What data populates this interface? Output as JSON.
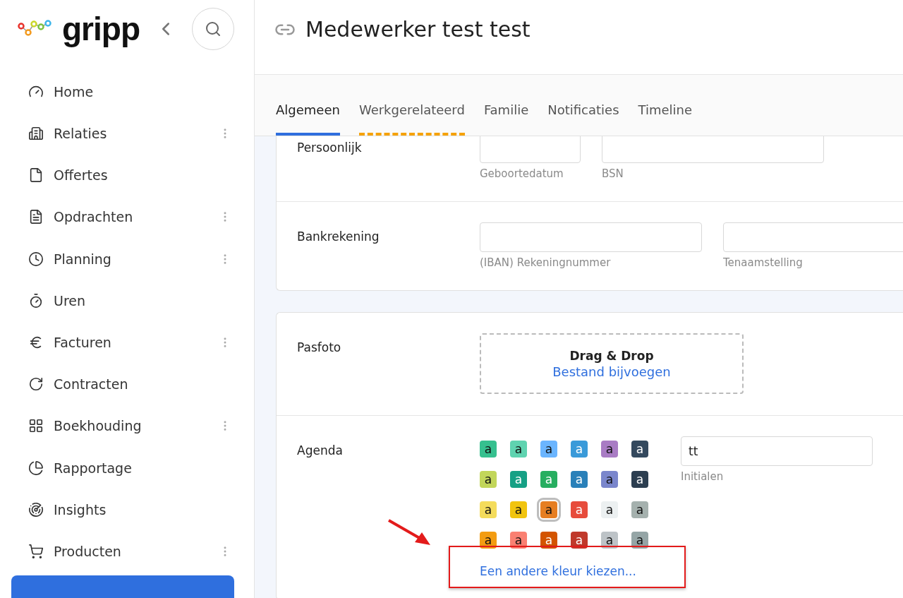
{
  "sidebar": {
    "logo": "gripp",
    "items": [
      {
        "label": "Home",
        "has_menu": false
      },
      {
        "label": "Relaties",
        "has_menu": true
      },
      {
        "label": "Offertes",
        "has_menu": false
      },
      {
        "label": "Opdrachten",
        "has_menu": true
      },
      {
        "label": "Planning",
        "has_menu": true
      },
      {
        "label": "Uren",
        "has_menu": false
      },
      {
        "label": "Facturen",
        "has_menu": true
      },
      {
        "label": "Contracten",
        "has_menu": false
      },
      {
        "label": "Boekhouding",
        "has_menu": true
      },
      {
        "label": "Rapportage",
        "has_menu": false
      },
      {
        "label": "Insights",
        "has_menu": false
      },
      {
        "label": "Producten",
        "has_menu": true
      }
    ]
  },
  "header": {
    "title": "Medewerker test test"
  },
  "tabs": [
    {
      "label": "Algemeen",
      "selected": true,
      "marked": false
    },
    {
      "label": "Werkgerelateerd",
      "selected": false,
      "marked": true
    },
    {
      "label": "Familie",
      "selected": false,
      "marked": false
    },
    {
      "label": "Notificaties",
      "selected": false,
      "marked": false
    },
    {
      "label": "Timeline",
      "selected": false,
      "marked": false
    }
  ],
  "sections": [
    {
      "label": "Persoonlijk",
      "fields": [
        {
          "hint": "Geboortedatum"
        },
        {
          "hint": "BSN"
        }
      ]
    },
    {
      "label": "Bankrekening",
      "fields": [
        {
          "hint": "(IBAN) Rekeningnummer"
        },
        {
          "hint": "Tenaamstelling"
        }
      ]
    }
  ],
  "pasfoto": {
    "label": "Pasfoto",
    "drop_title": "Drag & Drop",
    "drop_link": "Bestand bijvoegen"
  },
  "agenda": {
    "label": "Agenda",
    "swatches": [
      {
        "letter": "a",
        "color": "#36c08f",
        "light_text": false,
        "selected": false
      },
      {
        "letter": "a",
        "color": "#5fd3b0",
        "light_text": false,
        "selected": false
      },
      {
        "letter": "a",
        "color": "#6bb5ff",
        "light_text": false,
        "selected": false
      },
      {
        "letter": "a",
        "color": "#3a9ad9",
        "light_text": true,
        "selected": false
      },
      {
        "letter": "a",
        "color": "#a97cc4",
        "light_text": false,
        "selected": false
      },
      {
        "letter": "a",
        "color": "#34495e",
        "light_text": true,
        "selected": false
      },
      {
        "letter": "a",
        "color": "#c2d65a",
        "light_text": false,
        "selected": false
      },
      {
        "letter": "a",
        "color": "#16a085",
        "light_text": true,
        "selected": false
      },
      {
        "letter": "a",
        "color": "#27ae60",
        "light_text": true,
        "selected": false
      },
      {
        "letter": "a",
        "color": "#2980b9",
        "light_text": true,
        "selected": false
      },
      {
        "letter": "a",
        "color": "#7a86cc",
        "light_text": false,
        "selected": false
      },
      {
        "letter": "a",
        "color": "#2c3e50",
        "light_text": true,
        "selected": false
      },
      {
        "letter": "a",
        "color": "#f4dc5c",
        "light_text": false,
        "selected": false
      },
      {
        "letter": "a",
        "color": "#f1c40f",
        "light_text": false,
        "selected": false
      },
      {
        "letter": "a",
        "color": "#e67e22",
        "light_text": false,
        "selected": true
      },
      {
        "letter": "a",
        "color": "#e74c3c",
        "light_text": true,
        "selected": false
      },
      {
        "letter": "a",
        "color": "#ecf0f1",
        "light_text": false,
        "selected": false
      },
      {
        "letter": "a",
        "color": "#a5b1ae",
        "light_text": false,
        "selected": false
      },
      {
        "letter": "a",
        "color": "#f39c12",
        "light_text": false,
        "selected": false
      },
      {
        "letter": "a",
        "color": "#fa8072",
        "light_text": false,
        "selected": false
      },
      {
        "letter": "a",
        "color": "#d35400",
        "light_text": true,
        "selected": false
      },
      {
        "letter": "a",
        "color": "#c0392b",
        "light_text": true,
        "selected": false
      },
      {
        "letter": "a",
        "color": "#bdc3c7",
        "light_text": false,
        "selected": false
      },
      {
        "letter": "a",
        "color": "#95a5a6",
        "light_text": false,
        "selected": false
      }
    ],
    "initials": {
      "value": "tt",
      "hint": "Initialen"
    },
    "other_color_link": "Een andere kleur kiezen..."
  }
}
